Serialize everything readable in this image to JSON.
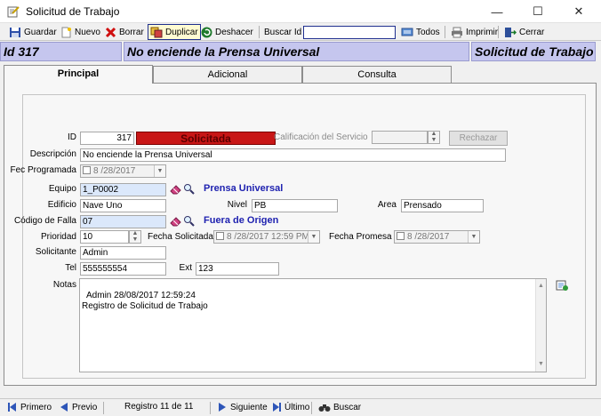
{
  "window": {
    "title": "Solicitud de Trabajo",
    "minimize": "—",
    "maximize": "☐",
    "close": "✕"
  },
  "toolbar": {
    "save": "Guardar",
    "new": "Nuevo",
    "delete": "Borrar",
    "duplicate": "Duplicar",
    "undo": "Deshacer",
    "search_label": "Buscar Id",
    "search_value": "",
    "all": "Todos",
    "print": "Imprimir",
    "close": "Cerrar"
  },
  "header": {
    "id": "Id  317",
    "description": "No enciende la Prensa Universal",
    "form_name": "Solicitud de Trabajo"
  },
  "tabs": [
    "Principal",
    "Adicional",
    "Consulta"
  ],
  "form": {
    "id_label": "ID",
    "id_value": "317",
    "status": "Solicitada",
    "rating_label": "Calificación del Servicio",
    "rating_value": "",
    "reject_button": "Rechazar",
    "description_label": "Descripción",
    "description_value": "No enciende la Prensa Universal",
    "scheduled_label": "Fec Programada",
    "scheduled_value": "8 /28/2017",
    "equipment_label": "Equipo",
    "equipment_value": "1_P0002",
    "equipment_name": "Prensa Universal",
    "building_label": "Edificio",
    "building_value": "Nave Uno",
    "level_label": "Nivel",
    "level_value": "PB",
    "area_label": "Area",
    "area_value": "Prensado",
    "failure_label": "Código de Falla",
    "failure_value": "07",
    "failure_name": "Fuera de Origen",
    "priority_label": "Prioridad",
    "priority_value": "10",
    "requested_label": "Fecha Solicitada",
    "requested_value": "8 /28/2017 12:59 PM",
    "promised_label": "Fecha Promesa",
    "promised_value": "8 /28/2017",
    "requester_label": "Solicitante",
    "requester_value": "Admin",
    "phone_label": "Tel",
    "phone_value": "555555554",
    "ext_label": "Ext",
    "ext_value": "123",
    "notes_label": "Notas",
    "notes_value": "Admin 28/08/2017 12:59:24\nRegistro de Solicitud de Trabajo"
  },
  "navigation": {
    "first": "Primero",
    "previous": "Previo",
    "record": "Registro 11 de 11",
    "next": "Siguiente",
    "last": "Último",
    "search": "Buscar"
  },
  "colors": {
    "header_bg": "#c5c6ee",
    "status_red": "#c81616",
    "link_blue": "#1f22b0",
    "field_blue": "#dbe8fb"
  }
}
